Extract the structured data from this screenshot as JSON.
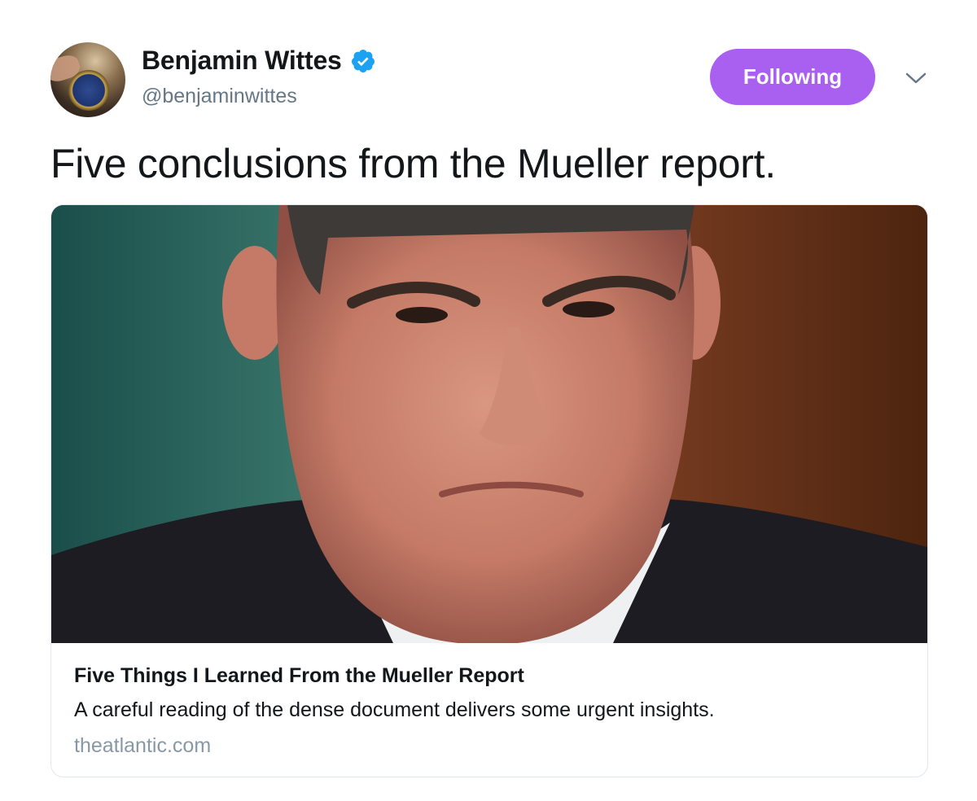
{
  "author": {
    "display_name": "Benjamin Wittes",
    "handle": "@benjaminwittes",
    "verified": true
  },
  "follow_button": {
    "label": "Following",
    "color": "#a95ff0"
  },
  "menu": {
    "icon": "chevron-down-icon"
  },
  "tweet": {
    "text": "Five conclusions from the Mueller report."
  },
  "card": {
    "title": "Five Things I Learned From the Mueller Report",
    "description": "A careful reading of the dense document delivers some urgent insights.",
    "domain": "theatlantic.com"
  },
  "colors": {
    "verified_blue": "#1da1f2",
    "handle_gray": "#657786",
    "domain_gray": "#8899a6",
    "border": "#e1e8ed"
  }
}
